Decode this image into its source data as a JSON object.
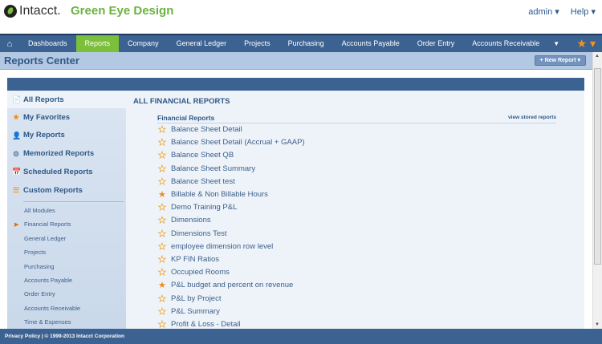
{
  "header": {
    "brand": "Intacct.",
    "company": "Green Eye Design",
    "admin": "admin ▾",
    "help": "Help ▾"
  },
  "nav": {
    "items": [
      "Dashboards",
      "Reports",
      "Company",
      "General Ledger",
      "Projects",
      "Purchasing",
      "Accounts Payable",
      "Order Entry",
      "Accounts Receivable"
    ],
    "active": "Reports"
  },
  "page": {
    "title": "Reports Center",
    "new_report": "+ New Report ▾"
  },
  "sidebar": {
    "items": [
      "All Reports",
      "My Favorites",
      "My Reports",
      "Memorized Reports",
      "Scheduled Reports",
      "Custom Reports"
    ],
    "selected": "All Reports",
    "modules": [
      "All Modules",
      "Financial Reports",
      "General Ledger",
      "Projects",
      "Purchasing",
      "Accounts Payable",
      "Order Entry",
      "Accounts Receivable",
      "Time & Expenses"
    ],
    "selected_module": "Financial Reports"
  },
  "main": {
    "heading": "ALL FINANCIAL REPORTS",
    "section": "Financial Reports",
    "stored_link": "view stored reports",
    "reports": [
      {
        "name": "Balance Sheet Detail",
        "favorite": false
      },
      {
        "name": "Balance Sheet Detail (Accrual + GAAP)",
        "favorite": false
      },
      {
        "name": "Balance Sheet QB",
        "favorite": false
      },
      {
        "name": "Balance Sheet Summary",
        "favorite": false
      },
      {
        "name": "Balance Sheet test",
        "favorite": false
      },
      {
        "name": "Billable & Non Billable Hours",
        "favorite": true
      },
      {
        "name": "Demo Training P&L",
        "favorite": false
      },
      {
        "name": "Dimensions",
        "favorite": false
      },
      {
        "name": "Dimensions Test",
        "favorite": false
      },
      {
        "name": "employee dimension row level",
        "favorite": false
      },
      {
        "name": "KP FIN Ratios",
        "favorite": false
      },
      {
        "name": "Occupied Rooms",
        "favorite": false
      },
      {
        "name": "P&L budget and percent on revenue",
        "favorite": true
      },
      {
        "name": "P&L by Project",
        "favorite": false
      },
      {
        "name": "P&L Summary",
        "favorite": false
      },
      {
        "name": "Profit & Loss - Detail",
        "favorite": false
      }
    ]
  },
  "footer": {
    "text": "Privacy Policy | © 1999-2013  Intacct Corporation"
  },
  "colors": {
    "nav": "#3c6291",
    "active_tab": "#7bbf3a",
    "brand_green": "#6cb33e",
    "favorite_star": "#f08a1c"
  }
}
